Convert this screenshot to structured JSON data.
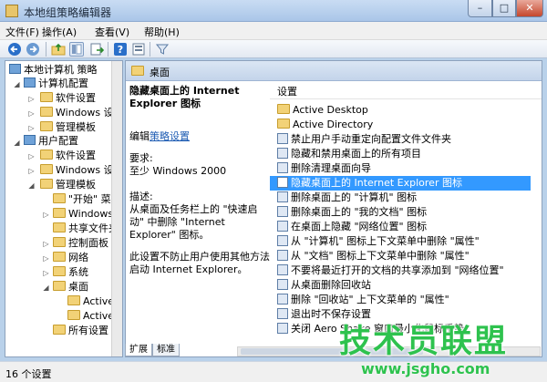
{
  "window": {
    "title": "本地组策略编辑器",
    "controls": {
      "minimize": "–",
      "maximize": "□",
      "close": "✕"
    }
  },
  "menubar": {
    "items": [
      "文件(F)",
      "操作(A)",
      "查看(V)",
      "帮助(H)"
    ]
  },
  "toolbar": {
    "icons": [
      "back-arrow-icon",
      "forward-arrow-icon",
      "up-folder-icon",
      "show-hide-tree-icon",
      "export-list-icon",
      "help-icon",
      "properties-icon",
      "filter-icon"
    ]
  },
  "tree": {
    "root": "本地计算机 策略",
    "computer_config": "计算机配置",
    "cc_software": "软件设置",
    "cc_windows": "Windows 设置",
    "cc_admin": "管理模板",
    "user_config": "用户配置",
    "uc_software": "软件设置",
    "uc_windows": "Windows 设置",
    "uc_admin": "管理模板",
    "start_menu": "\"开始\" 菜单",
    "windows_comp": "Windows 组",
    "shared_folders": "共享文件夹",
    "control_panel": "控制面板",
    "network": "网络",
    "system": "系统",
    "desktop": "桌面",
    "active_desktop": "Active De",
    "active_directory": "Active Dir",
    "all_settings": "所有设置"
  },
  "pane_header": "桌面",
  "description": {
    "title": "隐藏桌面上的 Internet Explorer 图标",
    "edit_prefix": "编辑",
    "edit_link": "策略设置",
    "req_label": "要求:",
    "req_value": "至少 Windows 2000",
    "desc_label": "描述:",
    "desc_text": "从桌面及任务栏上的 \"快速启动\" 中删除 \"Internet Explorer\" 图标。",
    "note": "此设置不防止用户使用其他方法启动 Internet Explorer。"
  },
  "settings": {
    "column": "设置",
    "rows": [
      {
        "label": "Active Desktop",
        "icon": "folder-icon"
      },
      {
        "label": "Active Directory",
        "icon": "folder-icon"
      },
      {
        "label": "禁止用户手动重定向配置文件文件夹",
        "icon": "policy-icon"
      },
      {
        "label": "隐藏和禁用桌面上的所有项目",
        "icon": "policy-icon"
      },
      {
        "label": "删除清理桌面向导",
        "icon": "policy-icon"
      },
      {
        "label": "隐藏桌面上的 Internet Explorer 图标",
        "icon": "policy-icon",
        "selected": true
      },
      {
        "label": "删除桌面上的 \"计算机\" 图标",
        "icon": "policy-icon"
      },
      {
        "label": "删除桌面上的 \"我的文档\" 图标",
        "icon": "policy-icon"
      },
      {
        "label": "在桌面上隐藏 \"网络位置\" 图标",
        "icon": "policy-icon"
      },
      {
        "label": "从 \"计算机\" 图标上下文菜单中删除 \"属性\"",
        "icon": "policy-icon"
      },
      {
        "label": "从 \"文档\" 图标上下文菜单中删除 \"属性\"",
        "icon": "policy-icon"
      },
      {
        "label": "不要将最近打开的文档的共享添加到 \"网络位置\"",
        "icon": "policy-icon"
      },
      {
        "label": "从桌面删除回收站",
        "icon": "policy-icon"
      },
      {
        "label": "删除 \"回收站\" 上下文菜单的 \"属性\"",
        "icon": "policy-icon"
      },
      {
        "label": "退出时不保存设置",
        "icon": "policy-icon"
      },
      {
        "label": "关闭 Aero Shake 窗口最小化鼠标手势",
        "icon": "policy-icon"
      }
    ]
  },
  "tabs": {
    "extended": "扩展",
    "standard": "标准"
  },
  "status": "16 个设置",
  "watermark": {
    "cn": "技术员联盟",
    "url": "www.jsgho.com"
  },
  "colors": {
    "selection": "#3399ff",
    "watermark": "#2ec24e",
    "folder": "#f2d277"
  }
}
